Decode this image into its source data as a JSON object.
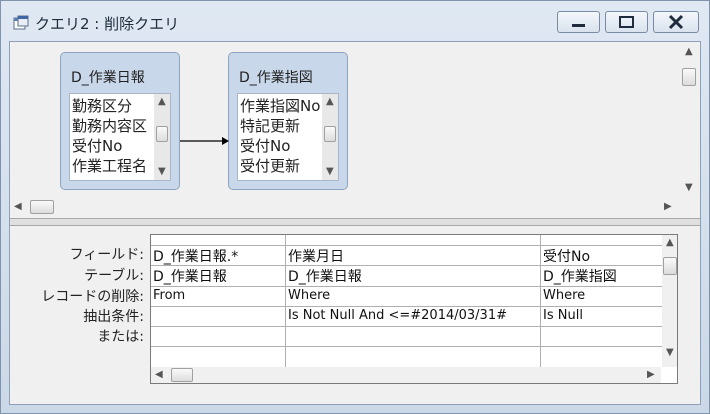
{
  "window": {
    "title": "クエリ2 : 削除クエリ",
    "icon": "query-icon"
  },
  "tables": [
    {
      "name": "D_作業日報",
      "fields": [
        "勤務区分",
        "勤務内容区",
        "受付No",
        "作業工程名"
      ]
    },
    {
      "name": "D_作業指図",
      "fields": [
        "作業指図No",
        "特記更新",
        "受付No",
        "受付更新"
      ]
    }
  ],
  "grid": {
    "row_labels": [
      "フィールド:",
      "テーブル:",
      "レコードの削除:",
      "抽出条件:",
      "または:"
    ],
    "columns": [
      {
        "field": "D_作業日報.*",
        "table": "D_作業日報",
        "delete": "From",
        "criteria": "",
        "or": ""
      },
      {
        "field": "作業月日",
        "table": "D_作業日報",
        "delete": "Where",
        "criteria": "Is Not Null And <=#2014/03/31#",
        "or": ""
      },
      {
        "field": "受付No",
        "table": "D_作業指図",
        "delete": "Where",
        "criteria": "Is Null",
        "or": ""
      }
    ]
  }
}
